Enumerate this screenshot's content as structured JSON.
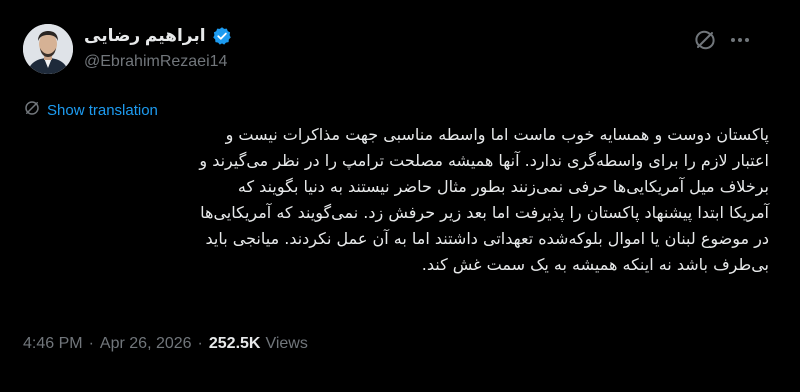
{
  "tweet": {
    "author": {
      "display_name": "ابراهیم رضایی",
      "handle": "@EbrahimRezaei14",
      "verified": true
    },
    "header_icons": [
      "grok-icon",
      "more-icon"
    ],
    "translate": {
      "icon": "translate-icon",
      "label": "Show translation"
    },
    "body_lines": [
      "پاکستان دوست و همسایه خوب ماست اما واسطه مناسبی جهت مذاکرات نیست و",
      "اعتبار لازم را برای واسطه‌گری ندارد. آنها همیشه مصلحت ترامپ را در نظر می‌گیرند و",
      "برخلاف میل آمریکایی‌ها حرفی نمی‌زنند بطور مثال حاضر نیستند به دنیا بگویند که",
      "آمریکا ابتدا پیشنهاد پاکستان را پذیرفت اما بعد زیر حرفش زد. نمی‌گویند که آمریکایی‌ها",
      "در موضوع لبنان یا اموال بلوکه‌شده تعهداتی داشتند اما به آن عمل نکردند. میانجی باید",
      "بی‌طرف باشد نه اینکه همیشه به یک سمت غش کند."
    ],
    "meta": {
      "time": "4:46 PM",
      "date": "Apr 26, 2026",
      "separator": "·",
      "views_count": "252.5K",
      "views_label": "Views"
    },
    "colors": {
      "background": "#000000",
      "text": "#e7e9ea",
      "secondary": "#71767b",
      "accent": "#1d9bf0"
    }
  }
}
